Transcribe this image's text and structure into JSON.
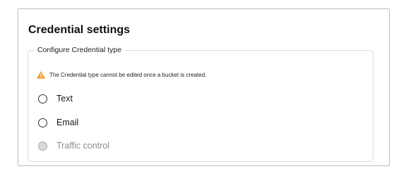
{
  "panel": {
    "title": "Credential settings"
  },
  "credential_type": {
    "legend": "Configure Credential type",
    "warning": {
      "icon": "warning-triangle-icon",
      "color": "#f0a030",
      "text": "The Credential type cannot be edited once a bucket is created."
    },
    "options": [
      {
        "label": "Text",
        "selected": false,
        "disabled": false
      },
      {
        "label": "Email",
        "selected": false,
        "disabled": false
      },
      {
        "label": "Traffic control",
        "selected": false,
        "disabled": true
      }
    ]
  }
}
